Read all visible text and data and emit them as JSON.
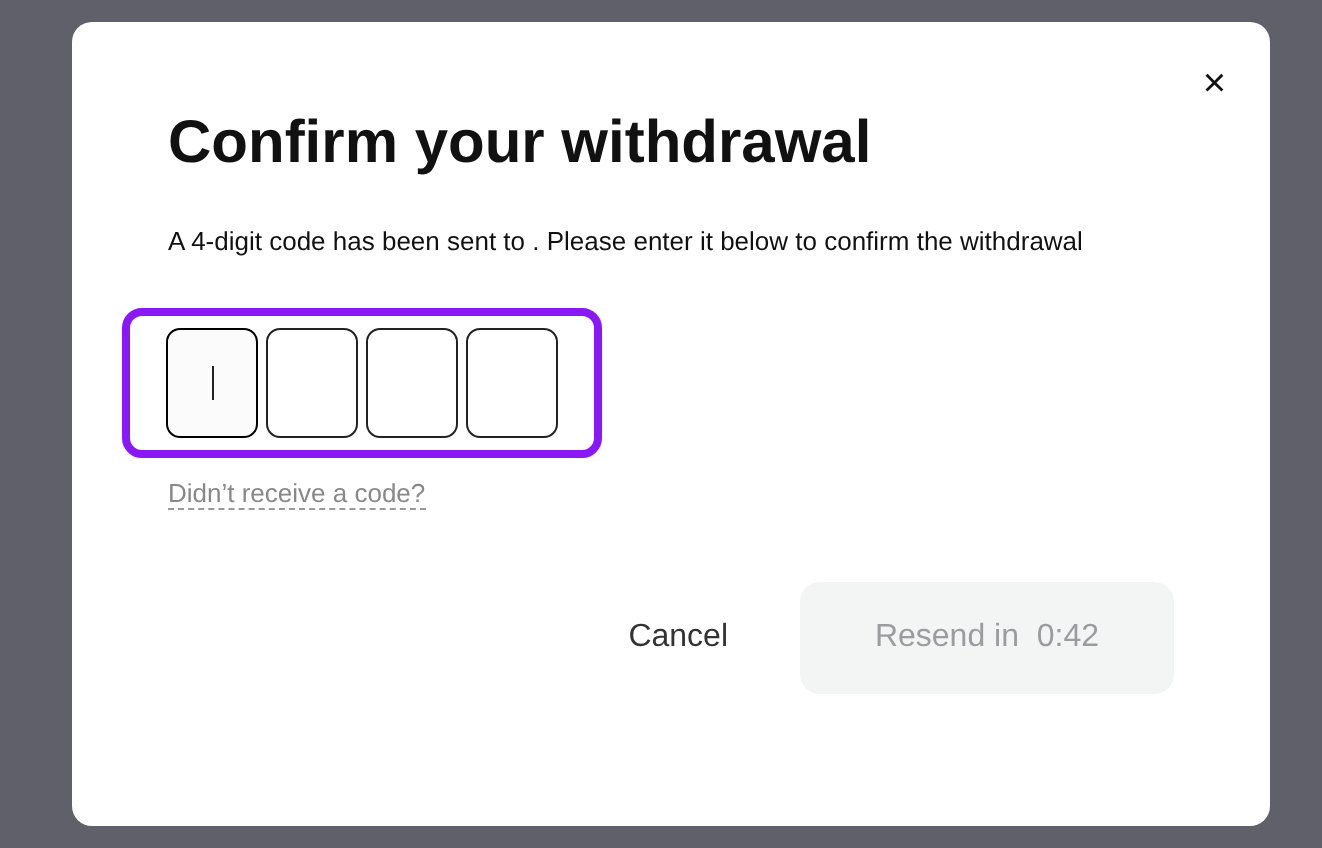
{
  "dialog": {
    "close": "×",
    "title": "Confirm your withdrawal",
    "description": "A 4-digit code has been sent to . Please enter it below to confirm the withdrawal",
    "code_group": {
      "focused": true,
      "cells": [
        {
          "focused": true
        },
        {
          "focused": false
        },
        {
          "focused": false
        },
        {
          "focused": false
        }
      ]
    },
    "help_link": "Didn’t receive a code?",
    "buttons": [
      {
        "kind": "text",
        "label": "Cancel",
        "disabled": false
      },
      {
        "kind": "filled",
        "label": "Resend in  0:42",
        "disabled": true
      }
    ]
  }
}
